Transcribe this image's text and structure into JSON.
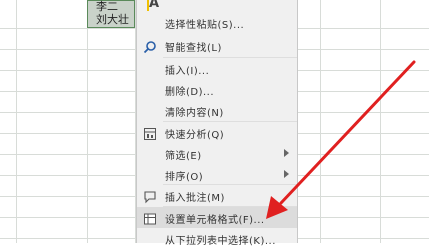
{
  "cells": {
    "line1": "李二",
    "line2": "刘大壮"
  },
  "mini_toolbar": {
    "letter": "A"
  },
  "menu": {
    "items": [
      {
        "label": "选择性粘贴(S)...",
        "icon": "none",
        "submenu": false
      },
      {
        "label": "智能查找(L)",
        "icon": "search-icon",
        "submenu": false
      },
      {
        "label": "插入(I)...",
        "icon": "none",
        "submenu": false
      },
      {
        "label": "删除(D)...",
        "icon": "none",
        "submenu": false
      },
      {
        "label": "清除内容(N)",
        "icon": "none",
        "submenu": false
      },
      {
        "label": "快速分析(Q)",
        "icon": "quick-analysis-icon",
        "submenu": false
      },
      {
        "label": "筛选(E)",
        "icon": "none",
        "submenu": true
      },
      {
        "label": "排序(O)",
        "icon": "none",
        "submenu": true
      },
      {
        "label": "插入批注(M)",
        "icon": "comment-icon",
        "submenu": false
      },
      {
        "label": "设置单元格格式(F)...",
        "icon": "format-cells-icon",
        "submenu": false,
        "highlighted": true
      },
      {
        "label": "从下拉列表中选择(K)...",
        "icon": "none",
        "submenu": false
      }
    ]
  },
  "colors": {
    "arrow": "#e02020",
    "menu_bg": "#f0f0f0",
    "highlight": "#dcdcdc"
  }
}
